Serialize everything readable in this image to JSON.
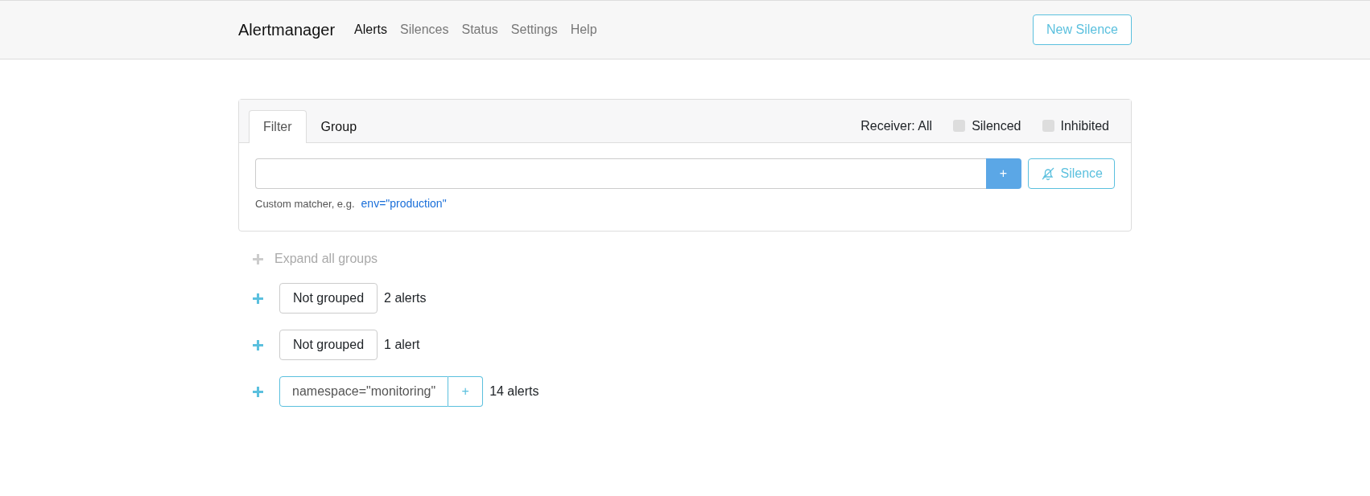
{
  "navbar": {
    "brand": "Alertmanager",
    "links": [
      {
        "label": "Alerts",
        "selected": true
      },
      {
        "label": "Silences",
        "selected": false
      },
      {
        "label": "Status",
        "selected": false
      },
      {
        "label": "Settings",
        "selected": false
      },
      {
        "label": "Help",
        "selected": false
      }
    ],
    "action": "New Silence"
  },
  "filter_panel": {
    "tabs": [
      {
        "label": "Filter",
        "selected": true
      },
      {
        "label": "Group",
        "selected": false
      }
    ],
    "receiver": "Receiver: All",
    "checkboxes": [
      {
        "label": "Silenced",
        "checked": false
      },
      {
        "label": "Inhibited",
        "checked": false
      }
    ],
    "add_button": "+",
    "silence_button": "Silence",
    "hint": "Custom matcher, e.g.",
    "hint_example": "env=\"production\""
  },
  "expand_all": {
    "label": "Expand all groups",
    "disabled": true
  },
  "groups": [
    {
      "kind": "plain",
      "label": "Not grouped",
      "count": "2 alerts"
    },
    {
      "kind": "plain",
      "label": "Not grouped",
      "count": "1 alert"
    },
    {
      "kind": "label",
      "label": "namespace=\"monitoring\"",
      "add": "+",
      "count": "14 alerts"
    }
  ]
}
